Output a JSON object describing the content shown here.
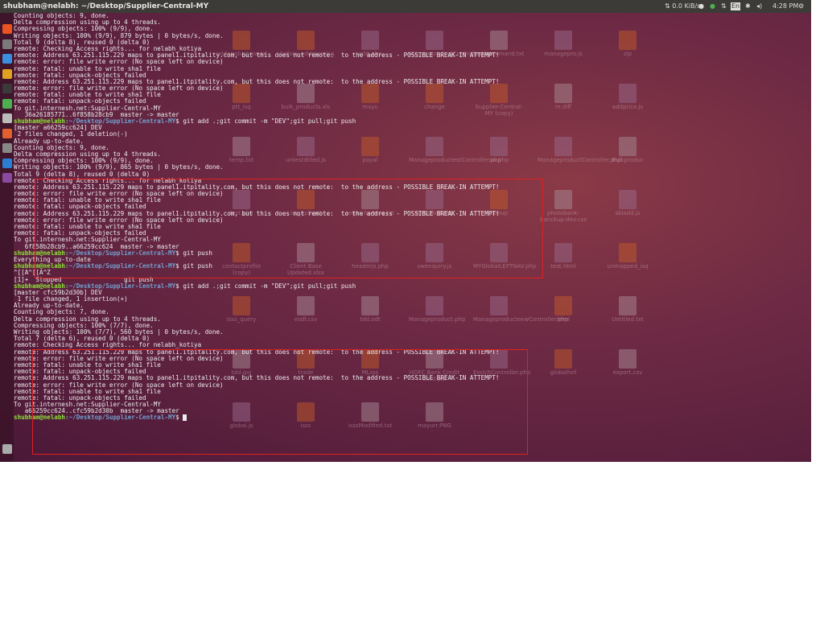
{
  "window_title": "shubham@nelabh: ~/Desktop/Supplier-Central-MY",
  "topbar": {
    "network": "0.0 KiB/s",
    "keyboard": "En",
    "time": "4:28 PM"
  },
  "colors": {
    "prompt_user": "#8ae234",
    "prompt_path": "#729fcf",
    "highlight_box": "#e02020",
    "panel": "#3c3b37"
  },
  "launcher_icons": [
    "ubuntu-icon",
    "files-icon",
    "chrome-icon",
    "terminal-app-icon",
    "filezilla-icon",
    "green-icon",
    "help-icon",
    "software-icon",
    "inkscape-icon",
    "teamviewer-icon",
    "app-icon",
    "trash-icon"
  ],
  "desktop_icons": [
    {
      "label": "addproduct_payal",
      "type": "folder"
    },
    {
      "label": "before_addmoreisq",
      "type": "folder"
    },
    {
      "label": "edit.php",
      "type": "code"
    },
    {
      "label": "ManageproductController.php",
      "type": "code"
    },
    {
      "label": "awk command.txt",
      "type": "file"
    },
    {
      "label": "managepro.js",
      "type": "code"
    },
    {
      "label": "zip",
      "type": "folder"
    },
    {
      "label": "ptt_isq",
      "type": "folder"
    },
    {
      "label": "bulk_products.xls",
      "type": "file"
    },
    {
      "label": "mayu",
      "type": "folder"
    },
    {
      "label": "change",
      "type": "folder"
    },
    {
      "label": "Supplier-Central-MY (copy)",
      "type": "folder"
    },
    {
      "label": "m.diff",
      "type": "file"
    },
    {
      "label": "addprice.js",
      "type": "code"
    },
    {
      "label": "temp.txt",
      "type": "file"
    },
    {
      "label": "untestdtiled.js",
      "type": "code"
    },
    {
      "label": "payal",
      "type": "folder"
    },
    {
      "label": "ManageproductestController.php",
      "type": "code"
    },
    {
      "label": "sw.php",
      "type": "code"
    },
    {
      "label": "ManageproductController.php",
      "type": "code"
    },
    {
      "label": "Bulkproduc",
      "type": "file"
    },
    {
      "label": "test.php",
      "type": "code"
    },
    {
      "label": "isq_upfront",
      "type": "folder"
    },
    {
      "label": "regex for root.txt",
      "type": "file"
    },
    {
      "label": "MYGlobal.php",
      "type": "code"
    },
    {
      "label": "popup",
      "type": "folder"
    },
    {
      "label": "photobank-banckup-dev.css",
      "type": "file"
    },
    {
      "label": "sbladd.js",
      "type": "code"
    },
    {
      "label": "contactprofile (copy)",
      "type": "folder"
    },
    {
      "label": "Client Base Updated.xlsx",
      "type": "file"
    },
    {
      "label": "headerjs.php",
      "type": "code"
    },
    {
      "label": "swenquiry.js",
      "type": "code"
    },
    {
      "label": "MYGlobalLEFTNAV.php",
      "type": "code"
    },
    {
      "label": "test.html",
      "type": "code"
    },
    {
      "label": "unmapped_isq",
      "type": "folder"
    },
    {
      "label": "isss_query",
      "type": "folder"
    },
    {
      "label": "esdf.csv",
      "type": "file"
    },
    {
      "label": "tdd.odt",
      "type": "file"
    },
    {
      "label": "Manageproduct.php",
      "type": "code"
    },
    {
      "label": "ManageproducteewController.php",
      "type": "code"
    },
    {
      "label": "html",
      "type": "folder"
    },
    {
      "label": "Untitled.txt",
      "type": "file"
    },
    {
      "label": "tdd.jpg",
      "type": "file"
    },
    {
      "label": "trade",
      "type": "folder"
    },
    {
      "label": "MLsss",
      "type": "folder"
    },
    {
      "label": "HDFC Bank Credit Card.pdf",
      "type": "file"
    },
    {
      "label": "EnrichController.php",
      "type": "code"
    },
    {
      "label": "globalhnf",
      "type": "folder"
    },
    {
      "label": "export.csv",
      "type": "file"
    },
    {
      "label": "global.js",
      "type": "code"
    },
    {
      "label": "isss",
      "type": "folder"
    },
    {
      "label": "isssModified.txt",
      "type": "file"
    },
    {
      "label": "mayurr.PNG",
      "type": "file"
    }
  ],
  "terminal": {
    "lines": [
      {
        "text": "Counting objects: 9, done."
      },
      {
        "text": "Delta compression using up to 4 threads."
      },
      {
        "text": "Compressing objects: 100% (9/9), done."
      },
      {
        "text": "Writing objects: 100% (9/9), 879 bytes | 0 bytes/s, done."
      },
      {
        "text": "Total 9 (delta 8), reused 0 (delta 0)"
      },
      {
        "text": "remote: Checking Access rights... for nelabh_kotiya"
      },
      {
        "text": "remote: Address 63.251.115.229 maps to panel1.itpitality.com, but this does not remote:  to the address - POSSIBLE BREAK-IN ATTEMPT!"
      },
      {
        "text": "remote: error: file write error (No space left on device)"
      },
      {
        "text": "remote: fatal: unable to write sha1 file"
      },
      {
        "text": "remote: fatal: unpack-objects failed"
      },
      {
        "text": "remote: Address 63.251.115.229 maps to panel1.itpitality.com, but this does not remote:  to the address - POSSIBLE BREAK-IN ATTEMPT!"
      },
      {
        "text": "remote: error: file write error (No space left on device)"
      },
      {
        "text": "remote: fatal: unable to write sha1 file"
      },
      {
        "text": "remote: fatal: unpack-objects failed"
      },
      {
        "text": "To git.internesh.net:Supplier-Central-MY"
      },
      {
        "text": "   36a26185771..6f858b28cb9  master -> master"
      },
      {
        "prompt_user": "shubham@nelabh",
        "prompt_path": ":~/Desktop/Supplier-Central-MY",
        "text": "$ git add .;git commit -m \"DEV\";git pull;git push"
      },
      {
        "text": "[master a66259cc624] DEV"
      },
      {
        "text": " 2 files changed, 1 deletion(-)"
      },
      {
        "text": "Already up-to-date."
      },
      {
        "text": "Counting objects: 9, done."
      },
      {
        "text": "Delta compression using up to 4 threads."
      },
      {
        "text": "Compressing objects: 100% (9/9), done."
      },
      {
        "text": "Writing objects: 100% (9/9), 865 bytes | 0 bytes/s, done."
      },
      {
        "text": "Total 9 (delta 8), reused 0 (delta 0)"
      },
      {
        "text": "remote: Checking Access rights... for nelabh_kotiya"
      },
      {
        "text": "remote: Address 63.251.115.229 maps to panel1.itpitality.com, but this does not remote:  to the address - POSSIBLE BREAK-IN ATTEMPT!"
      },
      {
        "text": "remote: error: file write error (No space left on device)"
      },
      {
        "text": "remote: fatal: unable to write sha1 file"
      },
      {
        "text": "remote: fatal: unpack-objects failed"
      },
      {
        "text": "remote: Address 63.251.115.229 maps to panel1.itpitality.com, but this does not remote:  to the address - POSSIBLE BREAK-IN ATTEMPT!"
      },
      {
        "text": "remote: error: file write error (No space left on device)"
      },
      {
        "text": "remote: fatal: unable to write sha1 file"
      },
      {
        "text": "remote: fatal: unpack-objects failed"
      },
      {
        "text": "To git.internesh.net:Supplier-Central-MY"
      },
      {
        "text": "   6f858b28cb9..a66259cc624  master -> master"
      },
      {
        "prompt_user": "shubham@nelabh",
        "prompt_path": ":~/Desktop/Supplier-Central-MY",
        "text": "$ git push"
      },
      {
        "text": "Everything up-to-date"
      },
      {
        "prompt_user": "shubham@nelabh",
        "prompt_path": ":~/Desktop/Supplier-Central-MY",
        "text": "$ git push"
      },
      {
        "text": "^[[A^[[A^Z"
      },
      {
        "text": "[1]+  Stopped                 git push"
      },
      {
        "prompt_user": "shubham@nelabh",
        "prompt_path": ":~/Desktop/Supplier-Central-MY",
        "text": "$ git add .;git commit -m \"DEV\";git pull;git push"
      },
      {
        "text": "[master cfc59b2d30b] DEV"
      },
      {
        "text": " 1 file changed, 1 insertion(+)"
      },
      {
        "text": "Already up-to-date."
      },
      {
        "text": "Counting objects: 7, done."
      },
      {
        "text": "Delta compression using up to 4 threads."
      },
      {
        "text": "Compressing objects: 100% (7/7), done."
      },
      {
        "text": "Writing objects: 100% (7/7), 560 bytes | 0 bytes/s, done."
      },
      {
        "text": "Total 7 (delta 6), reused 0 (delta 0)"
      },
      {
        "text": "remote: Checking Access rights... for nelabh_kotiya"
      },
      {
        "text": "remote: Address 63.251.115.229 maps to panel1.itpitality.com, but this does not remote:  to the address - POSSIBLE BREAK-IN ATTEMPT!"
      },
      {
        "text": "remote: error: file write error (No space left on device)"
      },
      {
        "text": "remote: fatal: unable to write sha1 file"
      },
      {
        "text": "remote: fatal: unpack-objects failed"
      },
      {
        "text": "remote: Address 63.251.115.229 maps to panel1.itpitality.com, but this does not remote:  to the address - POSSIBLE BREAK-IN ATTEMPT!"
      },
      {
        "text": "remote: error: file write error (No space left on device)"
      },
      {
        "text": "remote: fatal: unable to write sha1 file"
      },
      {
        "text": "remote: fatal: unpack-objects failed"
      },
      {
        "text": "To git.internesh.net:Supplier-Central-MY"
      },
      {
        "text": "   a66259cc624..cfc59b2d30b  master -> master"
      },
      {
        "prompt_user": "shubham@nelabh",
        "prompt_path": ":~/Desktop/Supplier-Central-MY",
        "text": "$ ",
        "cursor": true
      }
    ]
  }
}
